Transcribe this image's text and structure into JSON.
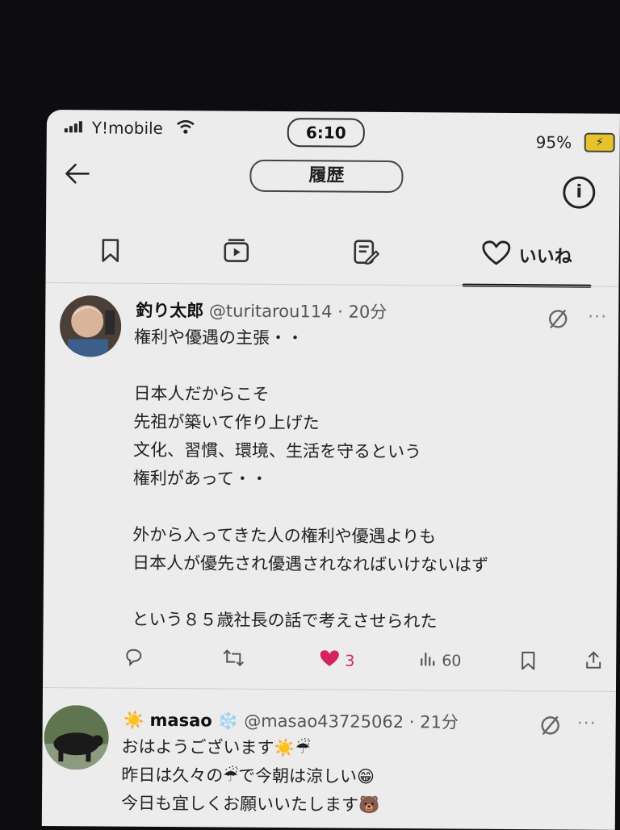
{
  "status_bar": {
    "carrier": "Y!mobile",
    "time": "6:10",
    "battery": "95%"
  },
  "header": {
    "title": "履歴"
  },
  "tabs": [
    {
      "icon": "bookmark-icon"
    },
    {
      "icon": "video-icon"
    },
    {
      "icon": "article-edit-icon"
    },
    {
      "icon": "heart-icon",
      "label": "いいね",
      "active": true
    }
  ],
  "tweets": [
    {
      "name": "釣り太郎",
      "handle": "@turitarou114",
      "time": "· 20分",
      "body": "権利や優遇の主張・・\n\n日本人だからこそ\n先祖が築いて作り上げた\n文化、習慣、環境、生活を守るという\n権利があって・・\n\n外から入ってきた人の権利や優遇よりも\n日本人が優先され優遇されなればいけないはず\n\nという８５歳社長の話で考えさせられた",
      "likes": "3",
      "views": "60",
      "liked": true
    },
    {
      "name": "masao",
      "handle": "@masao43725062",
      "time": "· 21分",
      "lines": [
        "おはようございます",
        "昨日は久々の",
        "で今朝は涼しい",
        "今日も宜しくお願いいたします"
      ]
    }
  ],
  "colors": {
    "accent_like": "#d6245f",
    "background": "#ececec"
  }
}
